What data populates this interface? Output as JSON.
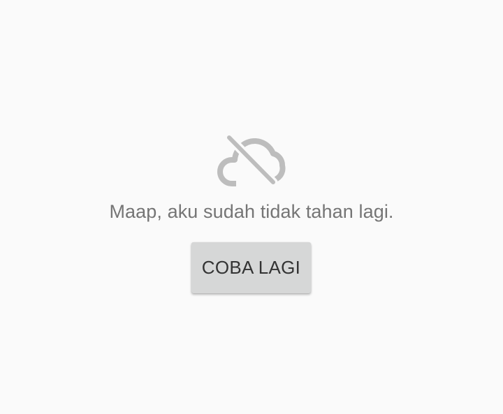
{
  "error": {
    "icon": "cloud-off-icon",
    "icon_color": "#bdbdbd",
    "message": "Maap, aku sudah tidak tahan lagi."
  },
  "retry_button": {
    "label": "COBA LAGI",
    "background": "#d6d7d7"
  },
  "background": "#fafafa"
}
